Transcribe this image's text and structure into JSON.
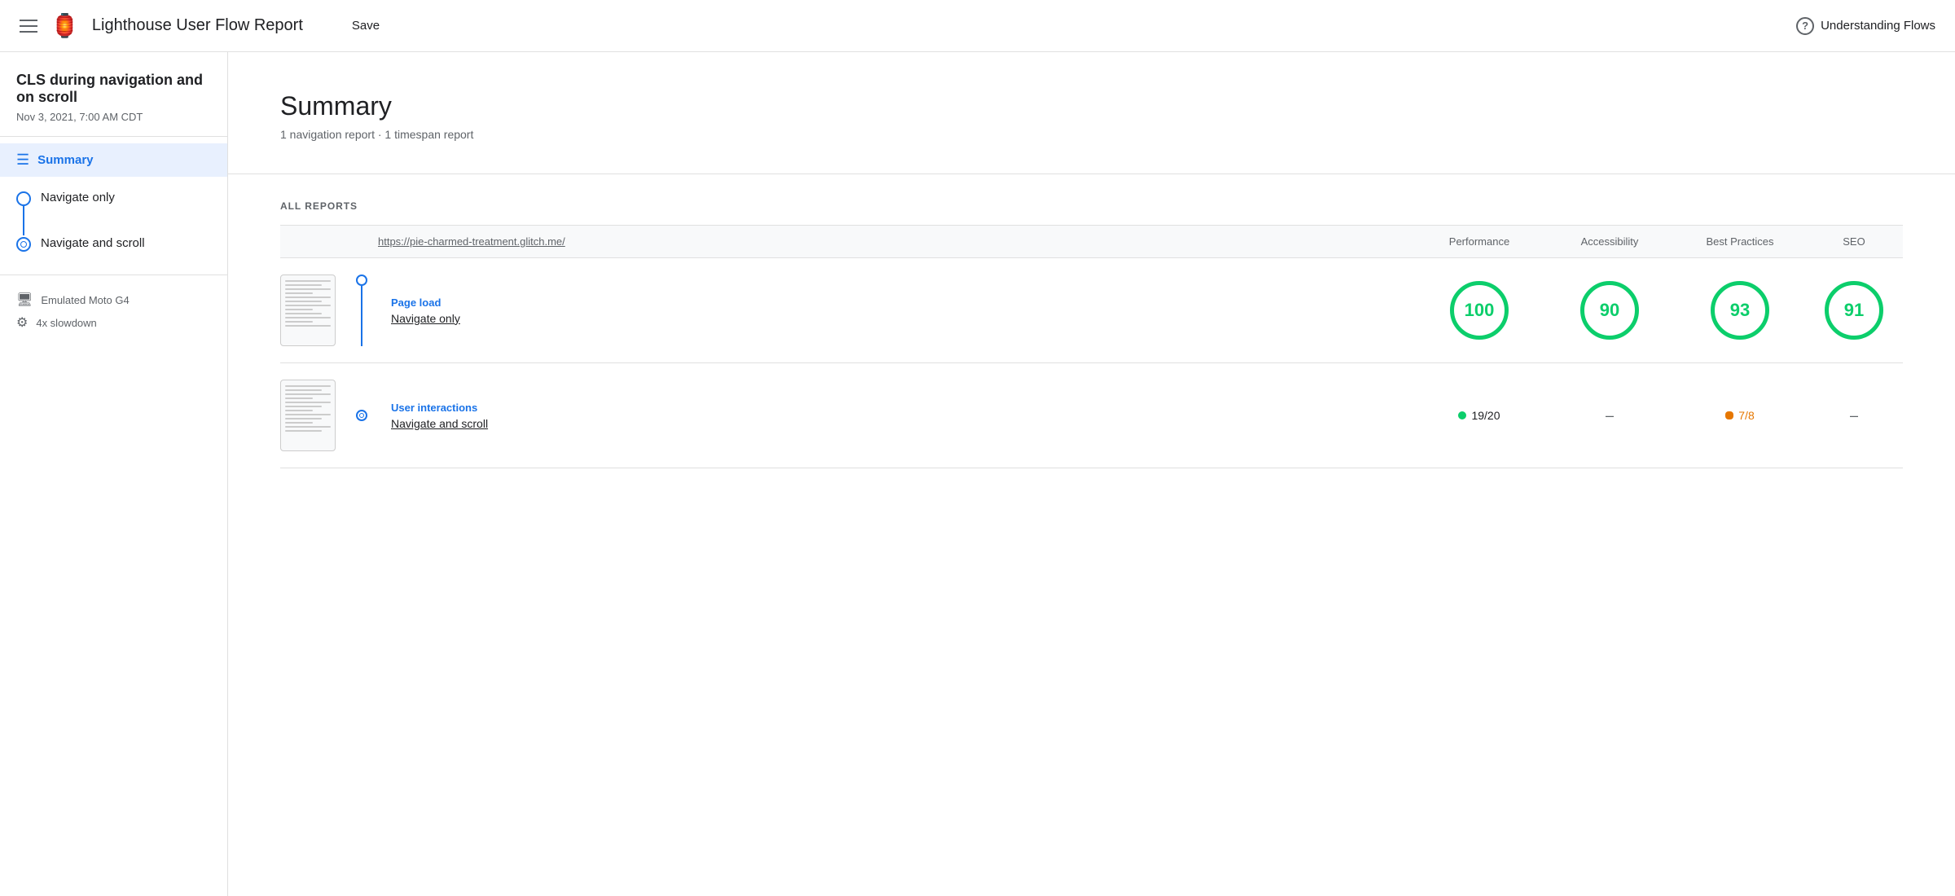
{
  "topbar": {
    "title": "Lighthouse User Flow Report",
    "save_label": "Save",
    "help_label": "Understanding Flows",
    "logo": "🏮"
  },
  "sidebar": {
    "project_title": "CLS during navigation and on scroll",
    "date": "Nov 3, 2021, 7:00 AM CDT",
    "summary_label": "Summary",
    "steps": [
      {
        "label": "Navigate only",
        "type": "circle"
      },
      {
        "label": "Navigate and scroll",
        "type": "clock"
      }
    ],
    "meta": [
      {
        "icon": "📱",
        "label": "Emulated Moto G4"
      },
      {
        "icon": "⚙️",
        "label": "4x slowdown"
      }
    ]
  },
  "main": {
    "summary": {
      "title": "Summary",
      "subtitle": "1 navigation report · 1 timespan report"
    },
    "reports": {
      "section_label": "ALL REPORTS",
      "url": "https://pie-charmed-treatment.glitch.me/",
      "columns": [
        "Performance",
        "Accessibility",
        "Best Practices",
        "SEO"
      ],
      "rows": [
        {
          "type": "Page load",
          "name": "Navigate only",
          "connector": "circle",
          "scores": [
            {
              "kind": "circle",
              "value": "100",
              "color": "#0cce6b"
            },
            {
              "kind": "circle",
              "value": "90",
              "color": "#0cce6b"
            },
            {
              "kind": "circle",
              "value": "93",
              "color": "#0cce6b"
            },
            {
              "kind": "circle",
              "value": "91",
              "color": "#0cce6b"
            }
          ]
        },
        {
          "type": "User interactions",
          "name": "Navigate and scroll",
          "connector": "clock",
          "scores": [
            {
              "kind": "badge-green",
              "value": "19/20"
            },
            {
              "kind": "dash"
            },
            {
              "kind": "badge-orange",
              "value": "7/8"
            },
            {
              "kind": "dash"
            }
          ]
        }
      ]
    }
  }
}
